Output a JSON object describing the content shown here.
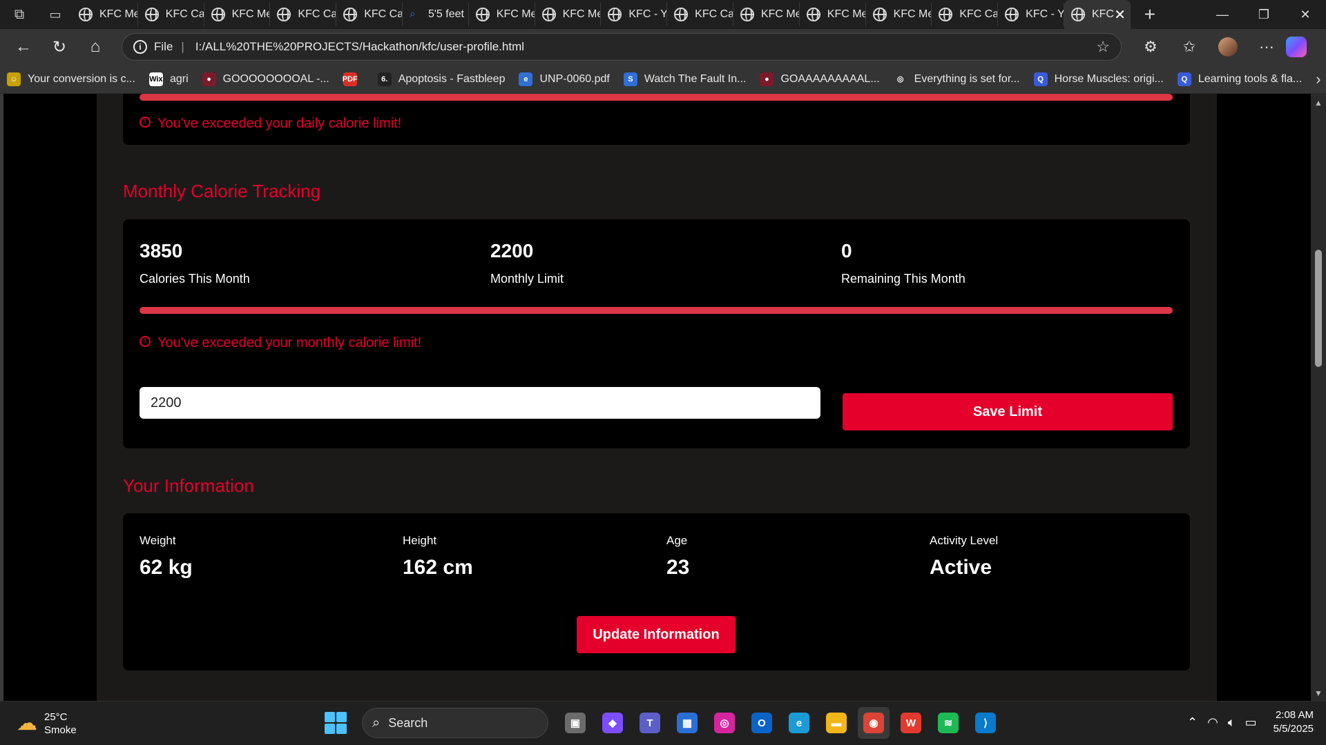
{
  "browser": {
    "tabs": [
      {
        "label": "KFC Me",
        "kind": "globe"
      },
      {
        "label": "KFC Cal",
        "kind": "globe"
      },
      {
        "label": "KFC Me",
        "kind": "globe"
      },
      {
        "label": "KFC Cal",
        "kind": "globe"
      },
      {
        "label": "KFC Cal",
        "kind": "globe"
      },
      {
        "label": "5'5 feet",
        "kind": "search"
      },
      {
        "label": "KFC Me",
        "kind": "globe"
      },
      {
        "label": "KFC Me",
        "kind": "globe"
      },
      {
        "label": "KFC - Yc",
        "kind": "globe"
      },
      {
        "label": "KFC Cal",
        "kind": "globe"
      },
      {
        "label": "KFC Me",
        "kind": "globe"
      },
      {
        "label": "KFC Me",
        "kind": "globe"
      },
      {
        "label": "KFC Me",
        "kind": "globe"
      },
      {
        "label": "KFC Cal",
        "kind": "globe"
      },
      {
        "label": "KFC - Yo",
        "kind": "globe"
      }
    ],
    "active_tab": {
      "label": "KFC"
    },
    "address": {
      "scheme": "File",
      "url": "I:/ALL%20THE%20PROJECTS/Hackathon/kfc/user-profile.html"
    },
    "bookmarks": [
      {
        "label": "Your conversion is c...",
        "color": "#c8a000",
        "glyph": "☺"
      },
      {
        "label": "agri",
        "color": "#ffffff",
        "glyph": "Wix"
      },
      {
        "label": "GOOOOOOOOAL -...",
        "color": "#7a1a2a",
        "glyph": "●"
      },
      {
        "label": "",
        "color": "#d93025",
        "glyph": "PDF"
      },
      {
        "label": "Apoptosis - Fastbleep",
        "color": "#222222",
        "glyph": "6."
      },
      {
        "label": "UNP-0060.pdf",
        "color": "#2f6fd6",
        "glyph": "e"
      },
      {
        "label": "Watch The Fault In...",
        "color": "#2f6fd6",
        "glyph": "S"
      },
      {
        "label": "GOAAAAAAAAAL...",
        "color": "#7a1a2a",
        "glyph": "●"
      },
      {
        "label": "Everything is set for...",
        "color": "#343434",
        "glyph": "◎"
      },
      {
        "label": "Horse Muscles: origi...",
        "color": "#3a5bd9",
        "glyph": "Q"
      },
      {
        "label": "Learning tools & fla...",
        "color": "#3a5bd9",
        "glyph": "Q"
      }
    ]
  },
  "daily": {
    "warning": "You've exceeded your daily calorie limit!"
  },
  "monthly": {
    "title": "Monthly Calorie Tracking",
    "stats": [
      {
        "value": "3850",
        "label": "Calories This Month"
      },
      {
        "value": "2200",
        "label": "Monthly Limit"
      },
      {
        "value": "0",
        "label": "Remaining This Month"
      }
    ],
    "progress_fraction": 1.0,
    "warning": "You've exceeded your monthly calorie limit!",
    "limit_input_value": "2200",
    "save_label": "Save Limit"
  },
  "info": {
    "title": "Your Information",
    "fields": [
      {
        "label": "Weight",
        "value": "62 kg"
      },
      {
        "label": "Height",
        "value": "162 cm"
      },
      {
        "label": "Age",
        "value": "23"
      },
      {
        "label": "Activity Level",
        "value": "Active"
      }
    ],
    "update_label": "Update Information"
  },
  "taskbar": {
    "weather": {
      "temp": "25°C",
      "condition": "Smoke"
    },
    "search_label": "Search",
    "time": "2:08 AM",
    "date": "5/5/2025",
    "apps": [
      {
        "name": "task-view",
        "color": "#6b6b6b",
        "glyph": "▣"
      },
      {
        "name": "copilot",
        "color": "#7d4dff",
        "glyph": "◆"
      },
      {
        "name": "teams",
        "color": "#5b5fc7",
        "glyph": "T"
      },
      {
        "name": "store",
        "color": "#2b6fd6",
        "glyph": "▦"
      },
      {
        "name": "instagram",
        "color": "#d6249f",
        "glyph": "◎"
      },
      {
        "name": "outlook",
        "color": "#0a64c8",
        "glyph": "O"
      },
      {
        "name": "edge",
        "color": "#1a9bd7",
        "glyph": "e"
      },
      {
        "name": "file-explorer",
        "color": "#f3b618",
        "glyph": "▬"
      },
      {
        "name": "chrome",
        "color": "#db4437",
        "glyph": "◉"
      },
      {
        "name": "wps",
        "color": "#e23a2e",
        "glyph": "W"
      },
      {
        "name": "spotify",
        "color": "#1db954",
        "glyph": "≋"
      },
      {
        "name": "vscode",
        "color": "#0a7acc",
        "glyph": "⟩"
      }
    ]
  }
}
